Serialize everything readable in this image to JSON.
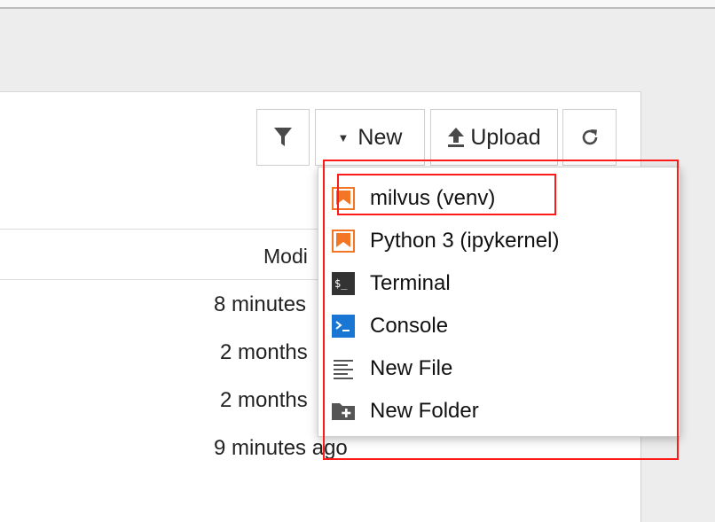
{
  "toolbar": {
    "new_label": "New",
    "upload_label": "Upload"
  },
  "table": {
    "column_header": "Modi",
    "rows": [
      {
        "modified": "8 minutes"
      },
      {
        "modified": "2 months"
      },
      {
        "modified": "2 months"
      },
      {
        "modified": "9 minutes ago"
      }
    ]
  },
  "new_menu": {
    "items": [
      {
        "label": "milvus (venv)",
        "icon": "notebook-icon"
      },
      {
        "label": "Python 3 (ipykernel)",
        "icon": "notebook-icon"
      },
      {
        "label": "Terminal",
        "icon": "terminal-icon"
      },
      {
        "label": "Console",
        "icon": "console-icon"
      },
      {
        "label": "New File",
        "icon": "file-icon"
      },
      {
        "label": "New Folder",
        "icon": "folder-icon"
      }
    ]
  },
  "colors": {
    "notebook_orange": "#f37626",
    "console_blue": "#1976d2",
    "annotation_red": "#ff1a1a"
  }
}
